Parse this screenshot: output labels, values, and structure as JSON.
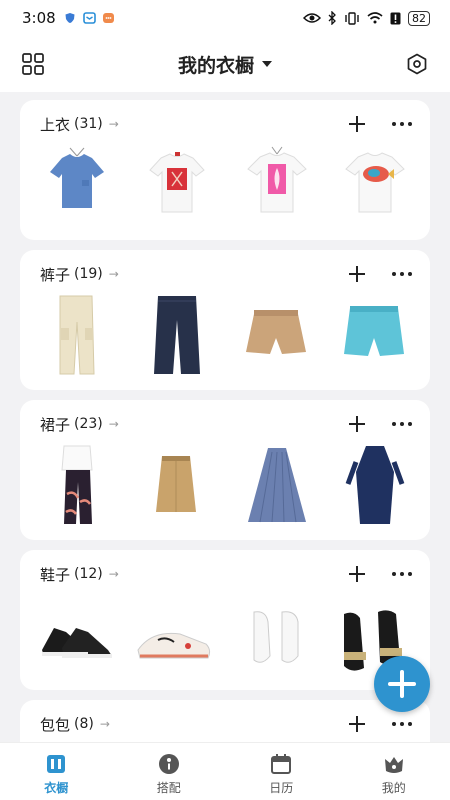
{
  "status_bar": {
    "time": "3:08",
    "battery": "82"
  },
  "header": {
    "title": "我的衣橱"
  },
  "categories": [
    {
      "name": "上衣",
      "count": "(31)",
      "items": [
        "blue-tshirt",
        "red-scarf-print-tee",
        "pink-leaf-print-tee",
        "fish-print-tee"
      ]
    },
    {
      "name": "裤子",
      "count": "(19)",
      "items": [
        "cream-cargo-pants",
        "dark-wide-jeans",
        "khaki-shorts",
        "denim-shorts"
      ]
    },
    {
      "name": "裙子",
      "count": "(23)",
      "items": [
        "printed-pants-outfit",
        "khaki-skirt",
        "pleated-blue-skirt",
        "navy-dress"
      ]
    },
    {
      "name": "鞋子",
      "count": "(12)",
      "items": [
        "black-hightop-sneakers",
        "colorful-dad-sneakers",
        "white-sneakers",
        "black-platform-sandals"
      ]
    },
    {
      "name": "包包",
      "count": "(8)",
      "items": []
    }
  ],
  "tabs": [
    {
      "label": "衣橱",
      "icon": "wardrobe-icon",
      "active": true
    },
    {
      "label": "搭配",
      "icon": "outfit-icon",
      "active": false
    },
    {
      "label": "日历",
      "icon": "calendar-icon",
      "active": false
    },
    {
      "label": "我的",
      "icon": "profile-icon",
      "active": false
    }
  ],
  "colors": {
    "accent": "#2e93cf",
    "background": "#f2f2f4",
    "card": "#ffffff"
  }
}
